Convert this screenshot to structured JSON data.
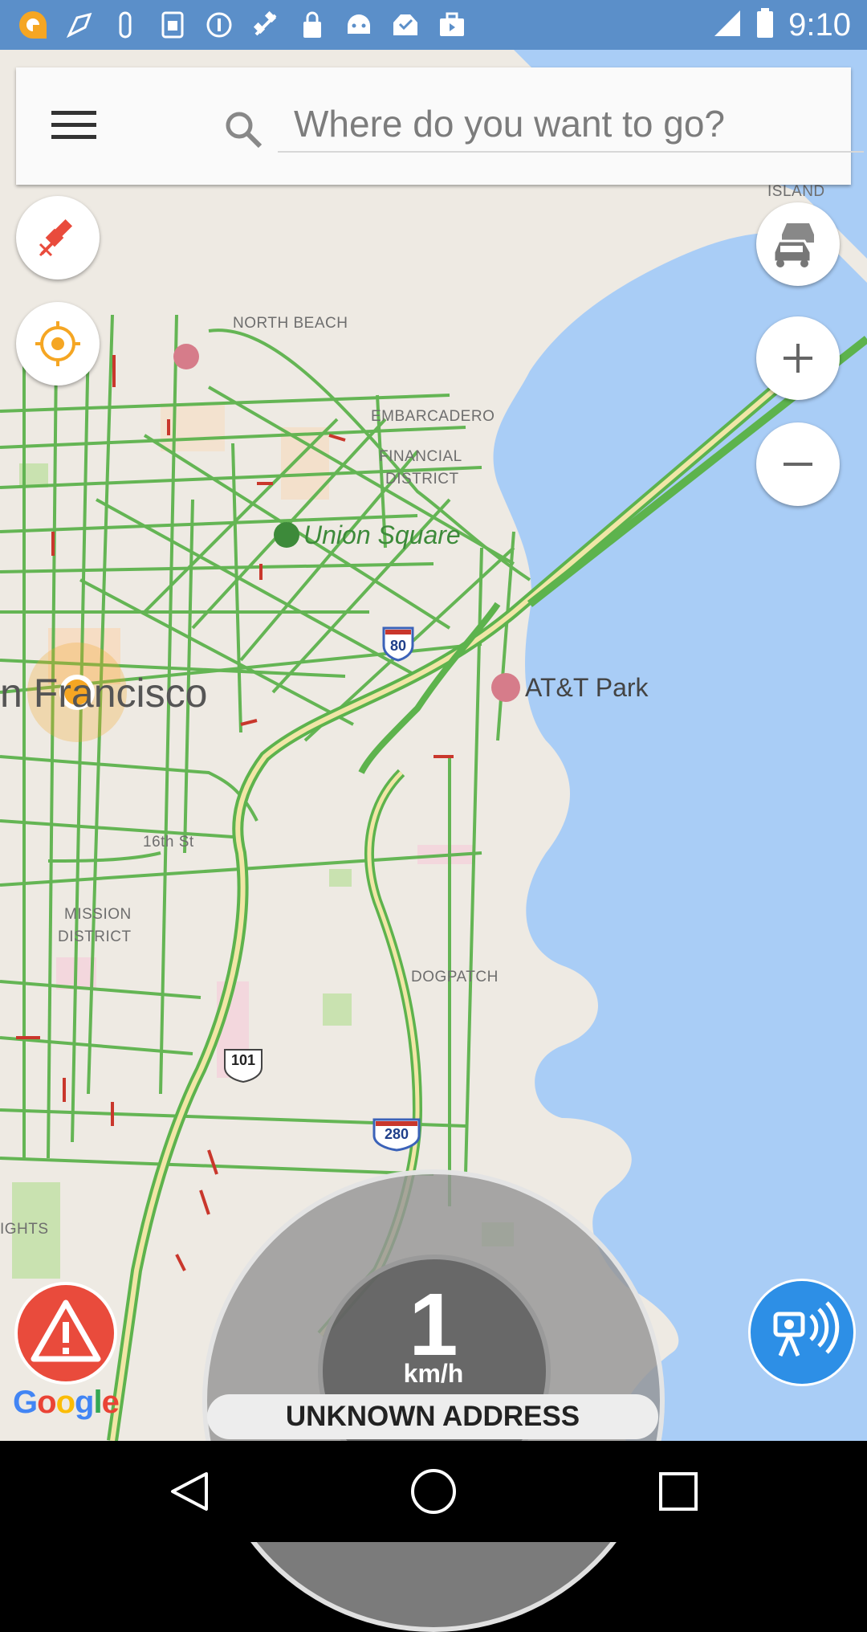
{
  "status_bar": {
    "time": "9:10",
    "icons": [
      "app-icon",
      "fruit-icon",
      "clip-icon",
      "sim-icon",
      "info-icon",
      "satellite-icon",
      "lock-icon",
      "android-icon",
      "inbox-icon",
      "briefcase-icon"
    ]
  },
  "search": {
    "placeholder": "Where do you want to go?"
  },
  "map": {
    "labels": {
      "island": "ISLAND",
      "north_beach": "NORTH BEACH",
      "embarcadero": "EMBARCADERO",
      "financial_1": "FINANCIAL",
      "financial_2": "DISTRICT",
      "union_square": "Union Square",
      "san_francisco": "n Francisco",
      "att_park": "AT&T Park",
      "street_16th": "16th St",
      "mission_1": "MISSION",
      "mission_2": "DISTRICT",
      "dogpatch": "DOGPATCH",
      "heights": "IGHTS",
      "shield_80": "80",
      "shield_101": "101",
      "shield_280": "280"
    }
  },
  "speedometer": {
    "value": "1",
    "unit": "km/h",
    "address": "UNKNOWN ADDRESS"
  },
  "attribution": {
    "google": [
      "G",
      "o",
      "o",
      "g",
      "l",
      "e"
    ]
  },
  "colors": {
    "status_bar": "#5b8fc9",
    "water": "#a9cdf6",
    "land": "#eeeae3",
    "road_green": "#5db34d",
    "road_red": "#c9372c",
    "accent_orange": "#f5a623",
    "camera_blue": "#2d8fe6"
  }
}
